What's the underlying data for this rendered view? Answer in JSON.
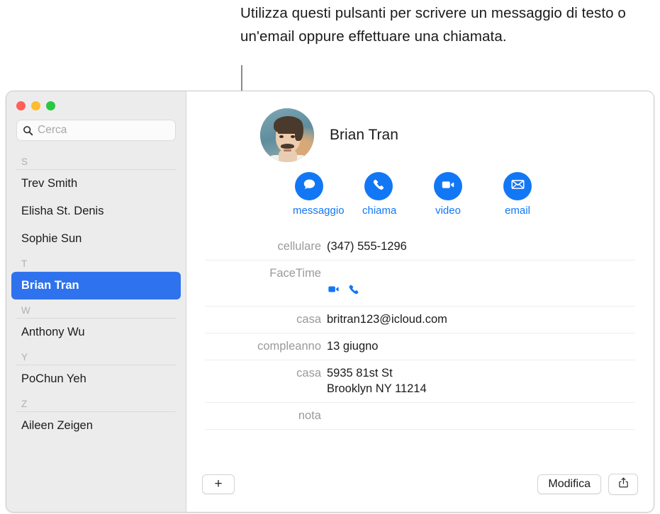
{
  "callout": {
    "text": "Utilizza questi pulsanti per scrivere un messaggio di testo o un'email oppure effettuare una chiamata."
  },
  "window": {
    "traffic_lights": [
      {
        "name": "close",
        "color": "#ff5f57"
      },
      {
        "name": "minimize",
        "color": "#febc2e"
      },
      {
        "name": "zoom",
        "color": "#28c840"
      }
    ]
  },
  "sidebar": {
    "search": {
      "placeholder": "Cerca",
      "value": "",
      "icon": "search-icon"
    },
    "groups": [
      {
        "letter": "S",
        "items": [
          "Trev Smith",
          "Elisha St. Denis",
          "Sophie Sun"
        ]
      },
      {
        "letter": "T",
        "items": [
          "Brian Tran"
        ]
      },
      {
        "letter": "W",
        "items": [
          "Anthony Wu"
        ]
      },
      {
        "letter": "Y",
        "items": [
          "PoChun Yeh"
        ]
      },
      {
        "letter": "Z",
        "items": [
          "Aileen Zeigen"
        ]
      }
    ],
    "selected": "Brian Tran",
    "selected_color": "#2f72ee"
  },
  "contact": {
    "name": "Brian Tran",
    "avatar": "contact-photo",
    "actions": [
      {
        "label": "messaggio",
        "icon": "message-bubble-icon"
      },
      {
        "label": "chiama",
        "icon": "phone-icon"
      },
      {
        "label": "video",
        "icon": "video-camera-icon"
      },
      {
        "label": "email",
        "icon": "envelope-icon"
      }
    ],
    "action_color": "#1277f5",
    "rows": [
      {
        "label": "cellulare",
        "value": "(347) 555-1296",
        "type": "text"
      },
      {
        "label": "FaceTime",
        "value": "",
        "type": "icons",
        "icons": [
          "video-camera-icon",
          "phone-icon"
        ]
      },
      {
        "label": "casa",
        "value": "britran123@icloud.com",
        "type": "text"
      },
      {
        "label": "compleanno",
        "value": "13 giugno",
        "type": "text"
      },
      {
        "label": "casa",
        "value": "5935 81st St\nBrooklyn NY 11214",
        "type": "text"
      },
      {
        "label": "nota",
        "value": "",
        "type": "text"
      }
    ]
  },
  "toolbar": {
    "add_label": "+",
    "edit_label": "Modifica",
    "share_icon": "share-icon"
  }
}
